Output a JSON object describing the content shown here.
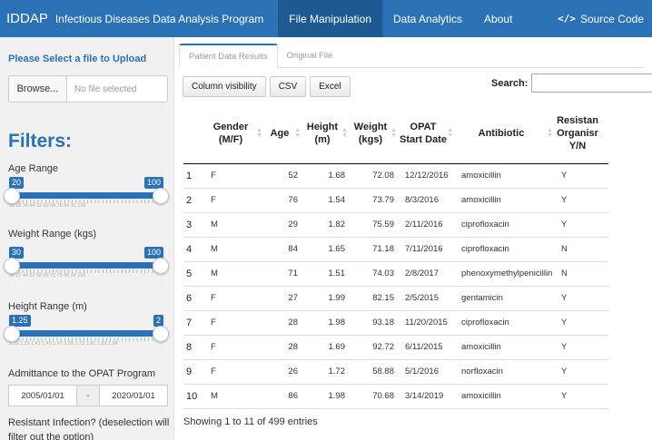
{
  "navbar": {
    "brand": "IDDAP",
    "subtitle": "Infectious Diseases Data Analysis Program",
    "items": [
      {
        "label": "File Manipulation",
        "active": true
      },
      {
        "label": "Data Analytics",
        "active": false
      },
      {
        "label": "About",
        "active": false
      }
    ],
    "source_code": "Source Code",
    "source_icon": "</>"
  },
  "sidebar": {
    "upload_label": "Please Select a file to Upload",
    "browse_label": "Browse...",
    "file_placeholder": "No file selected",
    "filters_title": "Filters:",
    "sliders": [
      {
        "label": "Age Range",
        "min": "20",
        "max": "100",
        "ticks": "20  28  36  44  52  60  68  76  84  92  100"
      },
      {
        "label": "Weight Range (kgs)",
        "min": "30",
        "max": "100",
        "ticks": "30  37  44  51  58  65  72  79  86  93  100"
      },
      {
        "label": "Height Range (m)",
        "min": "1.25",
        "max": "2",
        "ticks": "1.25 1.33 1.41 1.49 1.57 1.65 1.73 1.81 1.89 1.98"
      }
    ],
    "admittance_label": "Admittance to the OPAT Program",
    "date_start": "2005/01/01",
    "date_sep": "-",
    "date_end": "2020/01/01",
    "resistant_label": "Resistant Infection? (deselection will filter out the option)"
  },
  "main": {
    "tabs": [
      {
        "label": "Patient Data Results",
        "active": true
      },
      {
        "label": "Original File",
        "active": false
      }
    ],
    "buttons": [
      "Column visibility",
      "CSV",
      "Excel"
    ],
    "search_label": "Search:",
    "columns": [
      "",
      "Gender (M/F)",
      "Age",
      "Height (m)",
      "Weight (kgs)",
      "OPAT Start Date",
      "Antibiotic",
      "Resistan Organisr Y/N"
    ],
    "rows": [
      [
        "1",
        "F",
        "52",
        "1.68",
        "72.08",
        "12/12/2016",
        "amoxicillin",
        "Y"
      ],
      [
        "2",
        "F",
        "76",
        "1.54",
        "73.79",
        "8/3/2016",
        "amoxicillin",
        "Y"
      ],
      [
        "3",
        "M",
        "29",
        "1.82",
        "75.59",
        "2/11/2016",
        "ciprofloxacin",
        "Y"
      ],
      [
        "4",
        "M",
        "84",
        "1.65",
        "71.18",
        "7/11/2016",
        "ciprofloxacin",
        "N"
      ],
      [
        "5",
        "M",
        "71",
        "1.51",
        "74.03",
        "2/8/2017",
        "phenoxymethylpenicillin",
        "N"
      ],
      [
        "6",
        "F",
        "27",
        "1.99",
        "82.15",
        "2/5/2015",
        "gentamicin",
        "Y"
      ],
      [
        "7",
        "F",
        "28",
        "1.98",
        "93.18",
        "11/20/2015",
        "ciprofloxacin",
        "Y"
      ],
      [
        "8",
        "F",
        "28",
        "1.69",
        "92.72",
        "6/11/2015",
        "amoxicillin",
        "Y"
      ],
      [
        "9",
        "F",
        "26",
        "1.72",
        "58.88",
        "5/1/2016",
        "norfloxacin",
        "Y"
      ],
      [
        "10",
        "M",
        "86",
        "1.98",
        "70.68",
        "3/14/2019",
        "amoxicillin",
        "Y"
      ]
    ],
    "info": "Showing 1 to 11 of 499 entries"
  },
  "colors": {
    "accent": "#2a72b5",
    "nav_active": "#1d5a92",
    "sidebar_bg": "#f1f1f1"
  }
}
